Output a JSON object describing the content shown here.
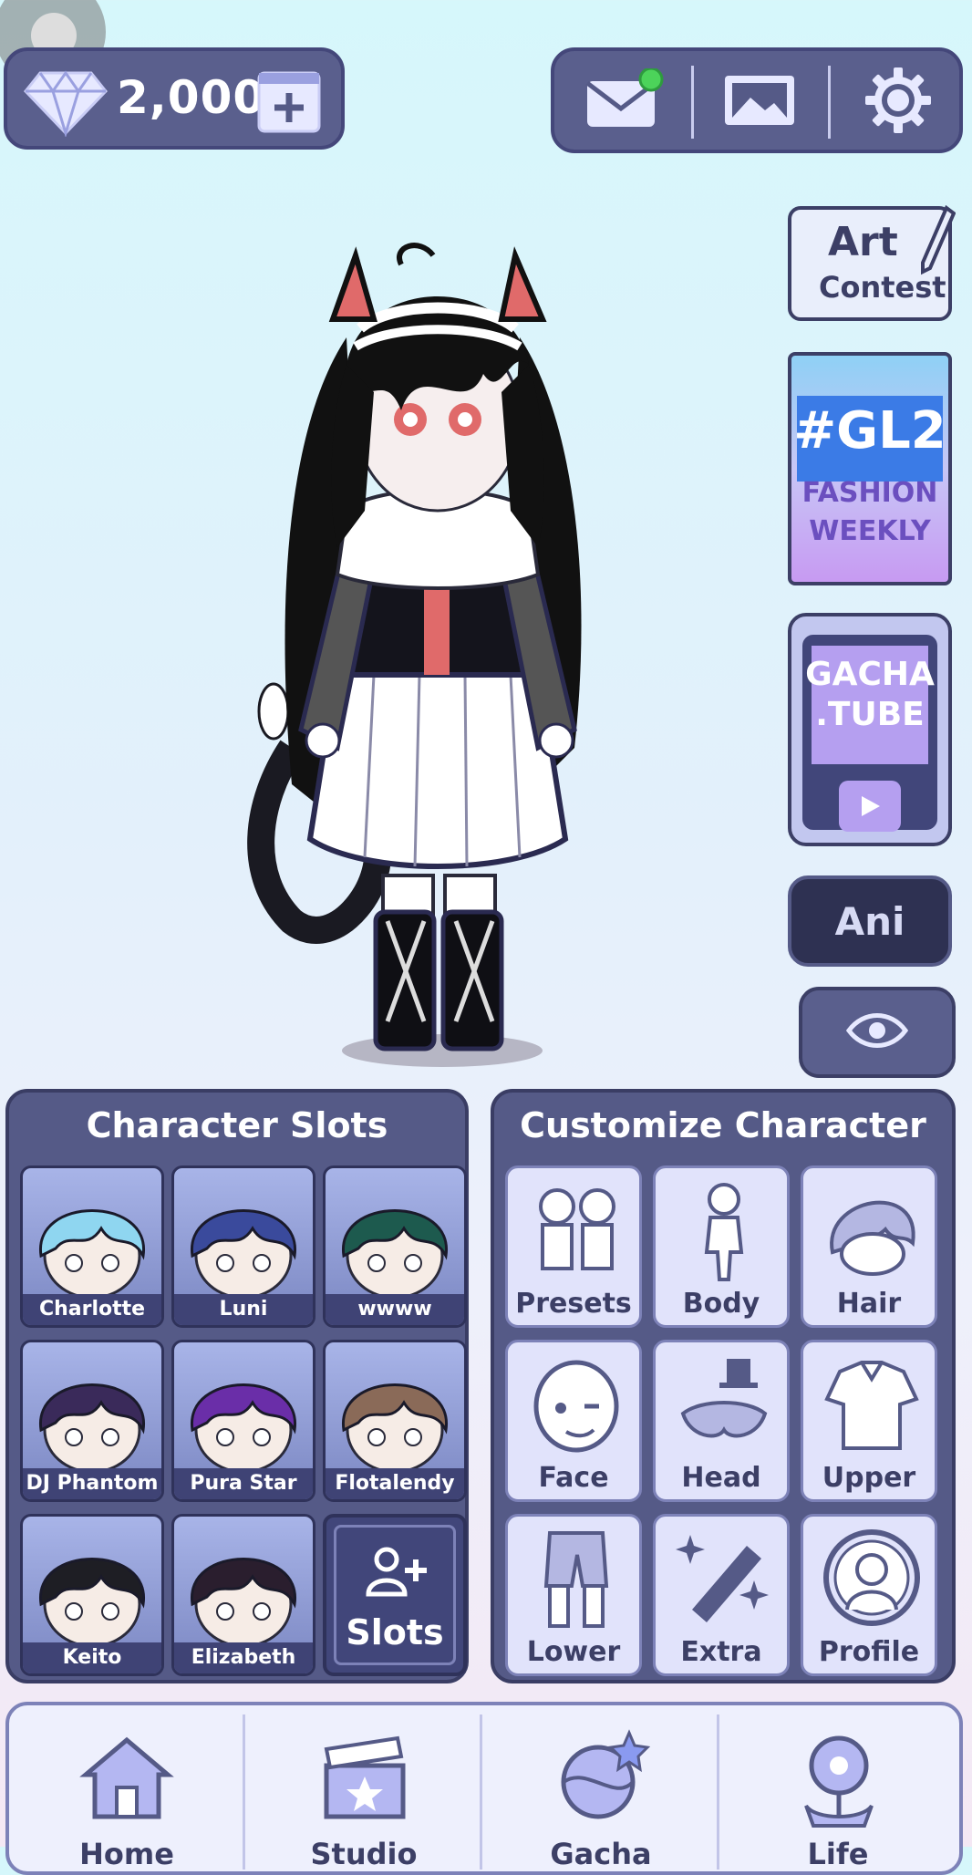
{
  "top_bar": {
    "gem_count": "2,000",
    "icons": [
      "gem-icon",
      "add-video-icon",
      "mail-icon",
      "gallery-icon",
      "settings-icon"
    ],
    "mail_notification_color": "#4cd35a"
  },
  "side_buttons": {
    "art_contest": {
      "line1": "Art",
      "line2": "Contest"
    },
    "fashion": {
      "line1": "#GL2",
      "line2": "FASHION",
      "line3": "WEEKLY"
    },
    "gacha_tube": {
      "line1": "GACHA",
      "line2": ".TUBE"
    },
    "ani_label": "Ani"
  },
  "character_slots": {
    "title": "Character Slots",
    "slots": [
      {
        "name": "Charlotte",
        "hair": "#8fd6f0"
      },
      {
        "name": "Luni",
        "hair": "#3a4a9c"
      },
      {
        "name": "wwww",
        "hair": "#1d5a4e"
      },
      {
        "name": "DJ Phantom",
        "hair": "#3a2a5a"
      },
      {
        "name": "Pura Star",
        "hair": "#6a2ea8"
      },
      {
        "name": "Flotalendy",
        "hair": "#8a6a58"
      },
      {
        "name": "Keito",
        "hair": "#1e1e24"
      },
      {
        "name": "Elizabeth",
        "hair": "#2a1e2e"
      }
    ],
    "add_slots_label": "Slots"
  },
  "customize": {
    "title": "Customize Character",
    "items": [
      {
        "label": "Presets",
        "icon": "presets-icon"
      },
      {
        "label": "Body",
        "icon": "body-icon"
      },
      {
        "label": "Hair",
        "icon": "hair-icon"
      },
      {
        "label": "Face",
        "icon": "face-icon"
      },
      {
        "label": "Head",
        "icon": "head-icon"
      },
      {
        "label": "Upper",
        "icon": "upper-icon"
      },
      {
        "label": "Lower",
        "icon": "lower-icon"
      },
      {
        "label": "Extra",
        "icon": "extra-icon"
      },
      {
        "label": "Profile",
        "icon": "profile-icon"
      }
    ]
  },
  "bottom_nav": {
    "items": [
      {
        "label": "Home",
        "icon": "home-icon"
      },
      {
        "label": "Studio",
        "icon": "studio-icon"
      },
      {
        "label": "Gacha",
        "icon": "gacha-icon"
      },
      {
        "label": "Life",
        "icon": "life-icon"
      }
    ]
  },
  "colors": {
    "panel": "#555a87",
    "panel_border": "#3a3d64",
    "accent_text": "#3c3f66"
  }
}
